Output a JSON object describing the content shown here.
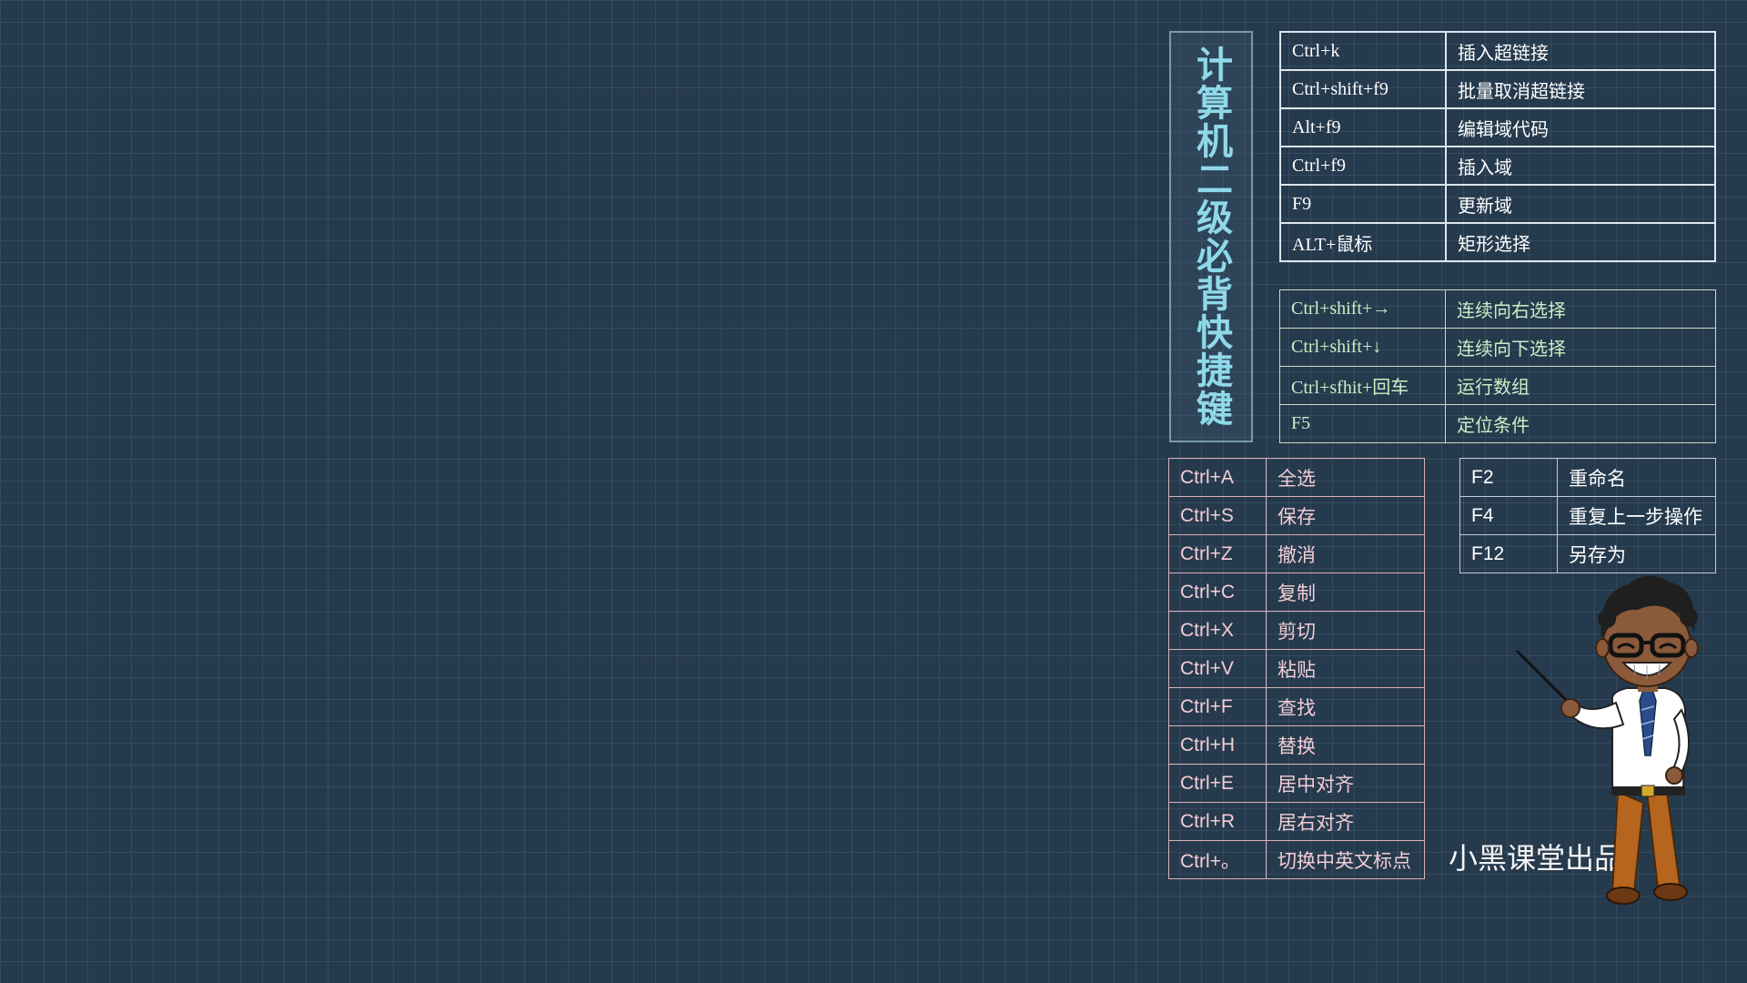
{
  "title": "计算机二级必背快捷键",
  "table_word": [
    {
      "key": "Ctrl+k",
      "action": "插入超链接"
    },
    {
      "key": "Ctrl+shift+f9",
      "action": "批量取消超链接"
    },
    {
      "key": "Alt+f9",
      "action": "编辑域代码"
    },
    {
      "key": "Ctrl+f9",
      "action": "插入域"
    },
    {
      "key": "F9",
      "action": "更新域"
    },
    {
      "key": "ALT+鼠标",
      "action": "矩形选择"
    }
  ],
  "table_excel": [
    {
      "key": "Ctrl+shift+→",
      "action": "连续向右选择"
    },
    {
      "key": "Ctrl+shift+↓",
      "action": "连续向下选择"
    },
    {
      "key": "Ctrl+sfhit+回车",
      "action": "运行数组"
    },
    {
      "key": "F5",
      "action": "定位条件"
    }
  ],
  "table_common": [
    {
      "key": "Ctrl+A",
      "action": "全选"
    },
    {
      "key": "Ctrl+S",
      "action": "保存"
    },
    {
      "key": "Ctrl+Z",
      "action": "撤消"
    },
    {
      "key": "Ctrl+C",
      "action": "复制"
    },
    {
      "key": "Ctrl+X",
      "action": "剪切"
    },
    {
      "key": "Ctrl+V",
      "action": "粘贴"
    },
    {
      "key": "Ctrl+F",
      "action": "查找"
    },
    {
      "key": "Ctrl+H",
      "action": "替换"
    },
    {
      "key": "Ctrl+E",
      "action": "居中对齐"
    },
    {
      "key": "Ctrl+R",
      "action": "居右对齐"
    },
    {
      "key": "Ctrl+。",
      "action": "切换中英文标点"
    }
  ],
  "table_function": [
    {
      "key": "F2",
      "action": "重命名"
    },
    {
      "key": "F4",
      "action": "重复上一步操作"
    },
    {
      "key": "F12",
      "action": "另存为"
    }
  ],
  "credit": "小黑课堂出品",
  "colors": {
    "background": "#263a4d",
    "title": "#8fd8ea",
    "table_word_text": "#ffffff",
    "table_excel_text": "#c9efc6",
    "table_common_text": "#f3cdd5",
    "table_function_text": "#ffffff"
  },
  "icons": {
    "mascot": "teacher-mascot-with-pointer"
  }
}
